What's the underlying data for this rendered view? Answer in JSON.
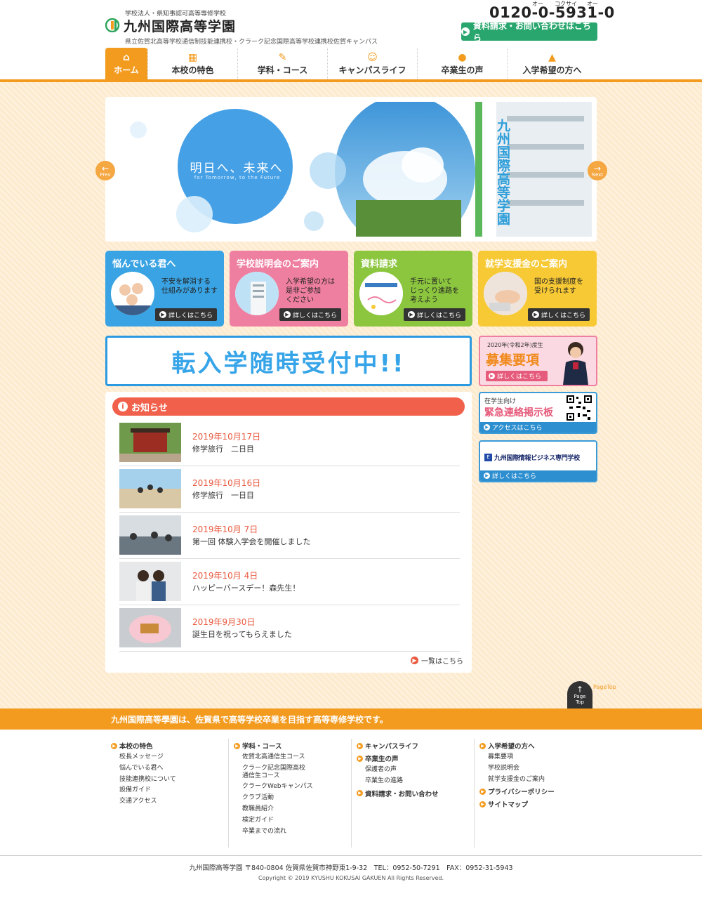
{
  "header": {
    "logo_sub": "学校法人・県知事認可高等専修学校",
    "logo_name": "九州国際高等学園",
    "logo_desc": "県立佐賀北高等学校通信制技能連携校・クラーク記念国際高等学校連携校佐賀キャンパス",
    "phone": "0120-0-5931-0",
    "phone_ruby": [
      "オー",
      "コクサイ",
      "オー"
    ],
    "contact_button": "資料請求・お問い合わせはこちら"
  },
  "nav": [
    {
      "label": "ホーム",
      "icon": "home-icon",
      "glyph": "⌂"
    },
    {
      "label": "本校の特色",
      "icon": "building-icon",
      "glyph": "▦"
    },
    {
      "label": "学科・コース",
      "icon": "pencil-icon",
      "glyph": "✎"
    },
    {
      "label": "キャンパスライフ",
      "icon": "smile-icon",
      "glyph": "☺"
    },
    {
      "label": "卒業生の声",
      "icon": "speech-bubble-icon",
      "glyph": "●"
    },
    {
      "label": "入学希望の方へ",
      "icon": "graduation-cap-icon",
      "glyph": "▲"
    }
  ],
  "slider": {
    "tagline": "明日へ、未来へ",
    "tagline_sub": "for Tomorrow, to the Future",
    "sign_text": "九州国際高等学園",
    "prev": "Prev",
    "next": "Next"
  },
  "cards": [
    {
      "title": "悩んでいる君へ",
      "text": [
        "不安を解消する",
        "仕組みがあります"
      ],
      "button": "詳しくはこちら",
      "color": "#3aa3e3"
    },
    {
      "title": "学校説明会のご案内",
      "text": [
        "入学希望の方は",
        "是非ご参加",
        "ください"
      ],
      "button": "詳しくはこちら",
      "color": "#ef7fa1"
    },
    {
      "title": "資料請求",
      "text": [
        "手元に置いて",
        "じっくり進路を",
        "考えよう"
      ],
      "button": "詳しくはこちら",
      "color": "#8cc63f"
    },
    {
      "title": "就学支援金のご案内",
      "text": [
        "国の支援制度を",
        "受けられます"
      ],
      "button": "詳しくはこちら",
      "color": "#f7c935"
    }
  ],
  "transfer_banner": "転入学随時受付中!!",
  "news": {
    "heading": "お知らせ",
    "items": [
      {
        "date": "2019年10月17日",
        "title": "修学旅行　二日目"
      },
      {
        "date": "2019年10月16日",
        "title": "修学旅行　一日目"
      },
      {
        "date": "2019年10月 7日",
        "title": "第一回 体験入学会を開催しました"
      },
      {
        "date": "2019年10月 4日",
        "title": "ハッピーバースデー！森先生！"
      },
      {
        "date": "2019年9月30日",
        "title": "誕生日を祝ってもらえました"
      }
    ],
    "more": "一覧はこちら"
  },
  "side": {
    "recruit_year": "2020年(令和2年)度生",
    "recruit_title": "募集要項",
    "recruit_button": "詳しくはこちら",
    "emergency_sub": "在学生向け",
    "emergency_title": "緊急連絡掲示板",
    "emergency_button": "アクセスはこちら",
    "business_title": "九州国際情報ビジネス専門学校",
    "business_button": "詳しくはこちら"
  },
  "pagetop": {
    "label1": "Page",
    "label2": "Top",
    "text": "PageTop"
  },
  "footer": {
    "tagline": "九州国際高等學園は、佐賀県で高等学校卒業を目指す高等専修学校です。",
    "col1": {
      "head": "本校の特色",
      "items": [
        "校長メッセージ",
        "悩んでいる君へ",
        "技能連携校について",
        "設備ガイド",
        "交通アクセス"
      ]
    },
    "col2": {
      "head": "学科・コース",
      "items": [
        "佐賀北高通信生コース",
        "クラーク記念国際高校",
        "通信生コース",
        "クラークWebキャンパス",
        "クラブ活動",
        "教職員紹介",
        "検定ガイド",
        "卒業までの流れ"
      ]
    },
    "col3": {
      "head1": "キャンパスライフ",
      "head2": "卒業生の声",
      "items": [
        "保護者の声",
        "卒業生の進路"
      ],
      "head3": "資料請求・お問い合わせ"
    },
    "col4": {
      "head1": "入学希望の方へ",
      "items": [
        "募集要項",
        "学校説明会",
        "就学支援金のご案内"
      ],
      "head2": "プライバシーポリシー",
      "head3": "サイトマップ"
    },
    "address": "九州国際高等学園 〒840-0804 佐賀県佐賀市神野東1-9-32　TEL：0952-50-7291　FAX：0952-31-5943",
    "copyright": "Copyright © 2019 KYUSHU KOKUSAI GAKUEN All Rights Reserved."
  }
}
